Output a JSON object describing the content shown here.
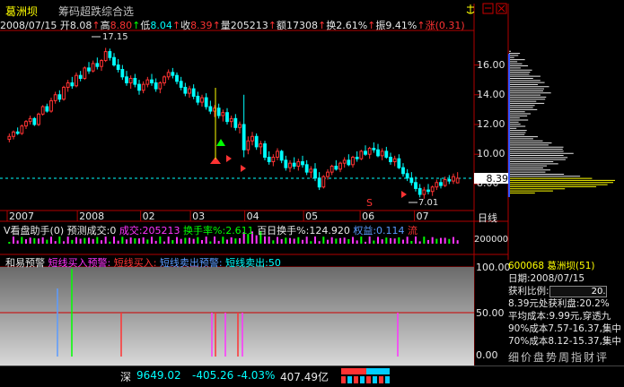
{
  "header": {
    "stock_name": "葛洲坝",
    "formula_name": "筹码超跌综合选",
    "date": "2008/07/15",
    "open_label": "开",
    "open": "8.08",
    "high_label": "高",
    "high": "8.80",
    "low_label": "低",
    "low": "8.04",
    "close_label": "收",
    "close": "8.39",
    "vol_label": "量",
    "vol": "205213",
    "amount_label": "额",
    "amount": "17308",
    "turnover_label": "换",
    "turnover": "2.61%",
    "amp_label": "振",
    "amp": "9.41%",
    "change_label": "涨",
    "change": "(0.31)"
  },
  "price_axis": {
    "labels": [
      "16.00",
      "14.00",
      "12.00",
      "10.00",
      "8.00"
    ],
    "current": "8.39"
  },
  "chart_data": {
    "type": "candlestick",
    "ylim": [
      6.4,
      18.2
    ],
    "annotations": {
      "high": "17.15",
      "low": "7.01"
    },
    "time_labels": [
      "2007",
      "2008",
      "02",
      "03",
      "04",
      "05",
      "06",
      "07"
    ],
    "dayline_label": "日线",
    "ohlc": [
      [
        11.0,
        11.4,
        10.8,
        11.2
      ],
      [
        11.2,
        11.6,
        11.0,
        11.5
      ],
      [
        11.5,
        11.8,
        11.3,
        11.4
      ],
      [
        11.4,
        12.0,
        11.3,
        11.9
      ],
      [
        11.9,
        12.3,
        11.7,
        12.2
      ],
      [
        12.2,
        12.6,
        12.0,
        12.4
      ],
      [
        12.4,
        12.5,
        11.9,
        12.0
      ],
      [
        12.0,
        12.8,
        11.9,
        12.7
      ],
      [
        12.7,
        13.3,
        12.6,
        13.2
      ],
      [
        13.2,
        13.4,
        12.8,
        12.9
      ],
      [
        12.9,
        13.8,
        12.8,
        13.6
      ],
      [
        13.6,
        14.2,
        13.4,
        14.0
      ],
      [
        14.0,
        14.3,
        13.5,
        13.7
      ],
      [
        13.7,
        14.6,
        13.6,
        14.5
      ],
      [
        14.5,
        15.0,
        14.2,
        14.8
      ],
      [
        14.8,
        15.2,
        14.4,
        14.6
      ],
      [
        14.6,
        15.5,
        14.5,
        15.3
      ],
      [
        15.3,
        15.6,
        14.9,
        15.1
      ],
      [
        15.1,
        15.9,
        15.0,
        15.8
      ],
      [
        15.8,
        16.2,
        15.4,
        15.6
      ],
      [
        15.6,
        16.3,
        15.5,
        16.1
      ],
      [
        16.1,
        16.5,
        15.7,
        15.9
      ],
      [
        15.9,
        16.4,
        15.6,
        16.3
      ],
      [
        16.3,
        17.15,
        16.2,
        16.9
      ],
      [
        16.9,
        17.1,
        16.3,
        16.5
      ],
      [
        16.5,
        16.8,
        15.9,
        16.0
      ],
      [
        16.0,
        16.4,
        15.5,
        15.7
      ],
      [
        15.7,
        16.0,
        15.0,
        15.2
      ],
      [
        15.2,
        15.6,
        14.6,
        14.8
      ],
      [
        14.8,
        15.3,
        14.4,
        15.1
      ],
      [
        15.1,
        15.4,
        14.5,
        14.7
      ],
      [
        14.7,
        15.0,
        14.0,
        14.3
      ],
      [
        14.3,
        14.9,
        14.1,
        14.7
      ],
      [
        14.7,
        15.2,
        14.5,
        15.0
      ],
      [
        15.0,
        15.4,
        14.6,
        14.8
      ],
      [
        14.8,
        15.1,
        14.2,
        14.4
      ],
      [
        14.4,
        14.9,
        14.1,
        14.8
      ],
      [
        14.8,
        15.3,
        14.6,
        15.2
      ],
      [
        15.2,
        15.7,
        15.0,
        15.5
      ],
      [
        15.5,
        15.8,
        15.1,
        15.3
      ],
      [
        15.3,
        15.5,
        14.7,
        14.9
      ],
      [
        14.9,
        15.2,
        14.3,
        14.5
      ],
      [
        14.5,
        14.8,
        13.9,
        14.1
      ],
      [
        14.1,
        14.6,
        13.8,
        14.4
      ],
      [
        14.4,
        14.7,
        13.7,
        13.9
      ],
      [
        13.9,
        14.2,
        13.3,
        13.5
      ],
      [
        13.5,
        14.0,
        13.2,
        13.8
      ],
      [
        13.8,
        14.1,
        13.0,
        13.2
      ],
      [
        13.2,
        13.6,
        12.7,
        12.9
      ],
      [
        12.9,
        13.3,
        12.5,
        13.1
      ],
      [
        13.1,
        13.4,
        12.4,
        12.6
      ],
      [
        12.6,
        13.0,
        12.2,
        12.8
      ],
      [
        12.8,
        13.1,
        12.0,
        12.2
      ],
      [
        12.2,
        12.6,
        11.8,
        12.4
      ],
      [
        12.4,
        12.7,
        11.6,
        11.8
      ],
      [
        11.8,
        12.2,
        11.4,
        12.0
      ],
      [
        12.0,
        14.0,
        9.8,
        10.3
      ],
      [
        10.3,
        11.2,
        10.0,
        10.9
      ],
      [
        10.9,
        11.5,
        10.6,
        11.2
      ],
      [
        11.2,
        11.4,
        10.3,
        10.5
      ],
      [
        10.5,
        10.9,
        10.0,
        10.7
      ],
      [
        10.7,
        10.9,
        9.6,
        9.8
      ],
      [
        9.8,
        10.2,
        9.3,
        9.5
      ],
      [
        9.5,
        10.0,
        9.2,
        9.8
      ],
      [
        9.8,
        10.4,
        9.6,
        10.2
      ],
      [
        10.2,
        10.3,
        9.4,
        9.6
      ],
      [
        9.6,
        9.9,
        8.9,
        9.1
      ],
      [
        9.1,
        9.6,
        8.8,
        9.4
      ],
      [
        9.4,
        9.8,
        9.0,
        9.2
      ],
      [
        9.2,
        9.7,
        8.9,
        9.5
      ],
      [
        9.5,
        9.9,
        9.1,
        9.3
      ],
      [
        9.3,
        9.6,
        8.6,
        8.8
      ],
      [
        8.8,
        9.2,
        8.4,
        9.0
      ],
      [
        9.0,
        9.4,
        8.2,
        8.4
      ],
      [
        8.4,
        8.8,
        7.6,
        7.8
      ],
      [
        7.8,
        8.6,
        7.7,
        8.5
      ],
      [
        8.5,
        9.0,
        8.3,
        8.8
      ],
      [
        8.8,
        9.3,
        8.6,
        9.2
      ],
      [
        9.2,
        9.6,
        8.9,
        9.0
      ],
      [
        9.0,
        9.5,
        8.8,
        9.4
      ],
      [
        9.4,
        9.8,
        9.1,
        9.6
      ],
      [
        9.6,
        10.0,
        9.2,
        9.3
      ],
      [
        9.3,
        9.9,
        9.1,
        9.8
      ],
      [
        9.8,
        10.2,
        9.5,
        9.7
      ],
      [
        9.7,
        10.3,
        9.6,
        10.2
      ],
      [
        10.2,
        10.6,
        9.9,
        10.0
      ],
      [
        10.0,
        10.5,
        9.7,
        10.4
      ],
      [
        10.4,
        10.8,
        10.1,
        10.3
      ],
      [
        10.3,
        10.7,
        9.8,
        9.9
      ],
      [
        9.9,
        10.4,
        9.6,
        10.2
      ],
      [
        10.2,
        10.5,
        9.7,
        9.8
      ],
      [
        9.8,
        10.1,
        9.3,
        9.5
      ],
      [
        9.5,
        9.9,
        9.2,
        9.7
      ],
      [
        9.7,
        10.0,
        9.0,
        9.1
      ],
      [
        9.1,
        9.4,
        8.5,
        8.7
      ],
      [
        8.7,
        9.0,
        8.2,
        8.4
      ],
      [
        8.4,
        8.8,
        7.9,
        8.1
      ],
      [
        8.1,
        8.5,
        7.5,
        7.7
      ],
      [
        7.7,
        8.0,
        7.1,
        7.3
      ],
      [
        7.3,
        7.8,
        7.01,
        7.6
      ],
      [
        7.6,
        8.0,
        7.3,
        7.5
      ],
      [
        7.5,
        7.9,
        7.2,
        7.8
      ],
      [
        7.8,
        8.3,
        7.6,
        8.1
      ],
      [
        8.1,
        8.4,
        7.7,
        7.9
      ],
      [
        7.9,
        8.5,
        7.8,
        8.3
      ],
      [
        8.3,
        8.6,
        8.0,
        8.2
      ],
      [
        8.2,
        8.7,
        8.0,
        8.5
      ],
      [
        8.08,
        8.8,
        8.04,
        8.39
      ]
    ]
  },
  "volume_panel": {
    "name": "V看盘助手(0)",
    "predict_label": "预测成交:0",
    "turnover_vol_label": "成交:205213",
    "turnover_rate_label": "换手率%:2.611",
    "hundred_day_label": "百日换手%:124.920",
    "equity_label": "权益:0.114",
    "flow_label": "流",
    "axis_label": "200000"
  },
  "signal_panel": {
    "name": "和易预警",
    "items": [
      "短线买入预警:",
      "短线买入:",
      "短线卖出预警:",
      "短线卖出:50"
    ],
    "axis": [
      "100.00",
      "50.00",
      "0.00"
    ]
  },
  "info_panel": {
    "code_name": "600068 葛洲坝(51)",
    "date_label": "日期:2008/07/15",
    "profit_label": "获利比例:",
    "profit_value": "20.",
    "line1": "8.39元处获利盘:20.2%",
    "line2": "平均成本:9.99元,穿透九",
    "line3": "90%成本7.57-16.37,集中",
    "line4": "70%成本8.12-15.37,集中",
    "tabs": "细价盘势周指财评"
  },
  "status": {
    "index_name": "深",
    "index_value": "9649.02",
    "index_change": "-405.26",
    "index_pct": "-4.03%",
    "index_amount": "407.49亿"
  },
  "colors": {
    "up": "#ff3333",
    "down": "#00ffff",
    "grid": "#8b0000",
    "frame": "#b00000"
  }
}
